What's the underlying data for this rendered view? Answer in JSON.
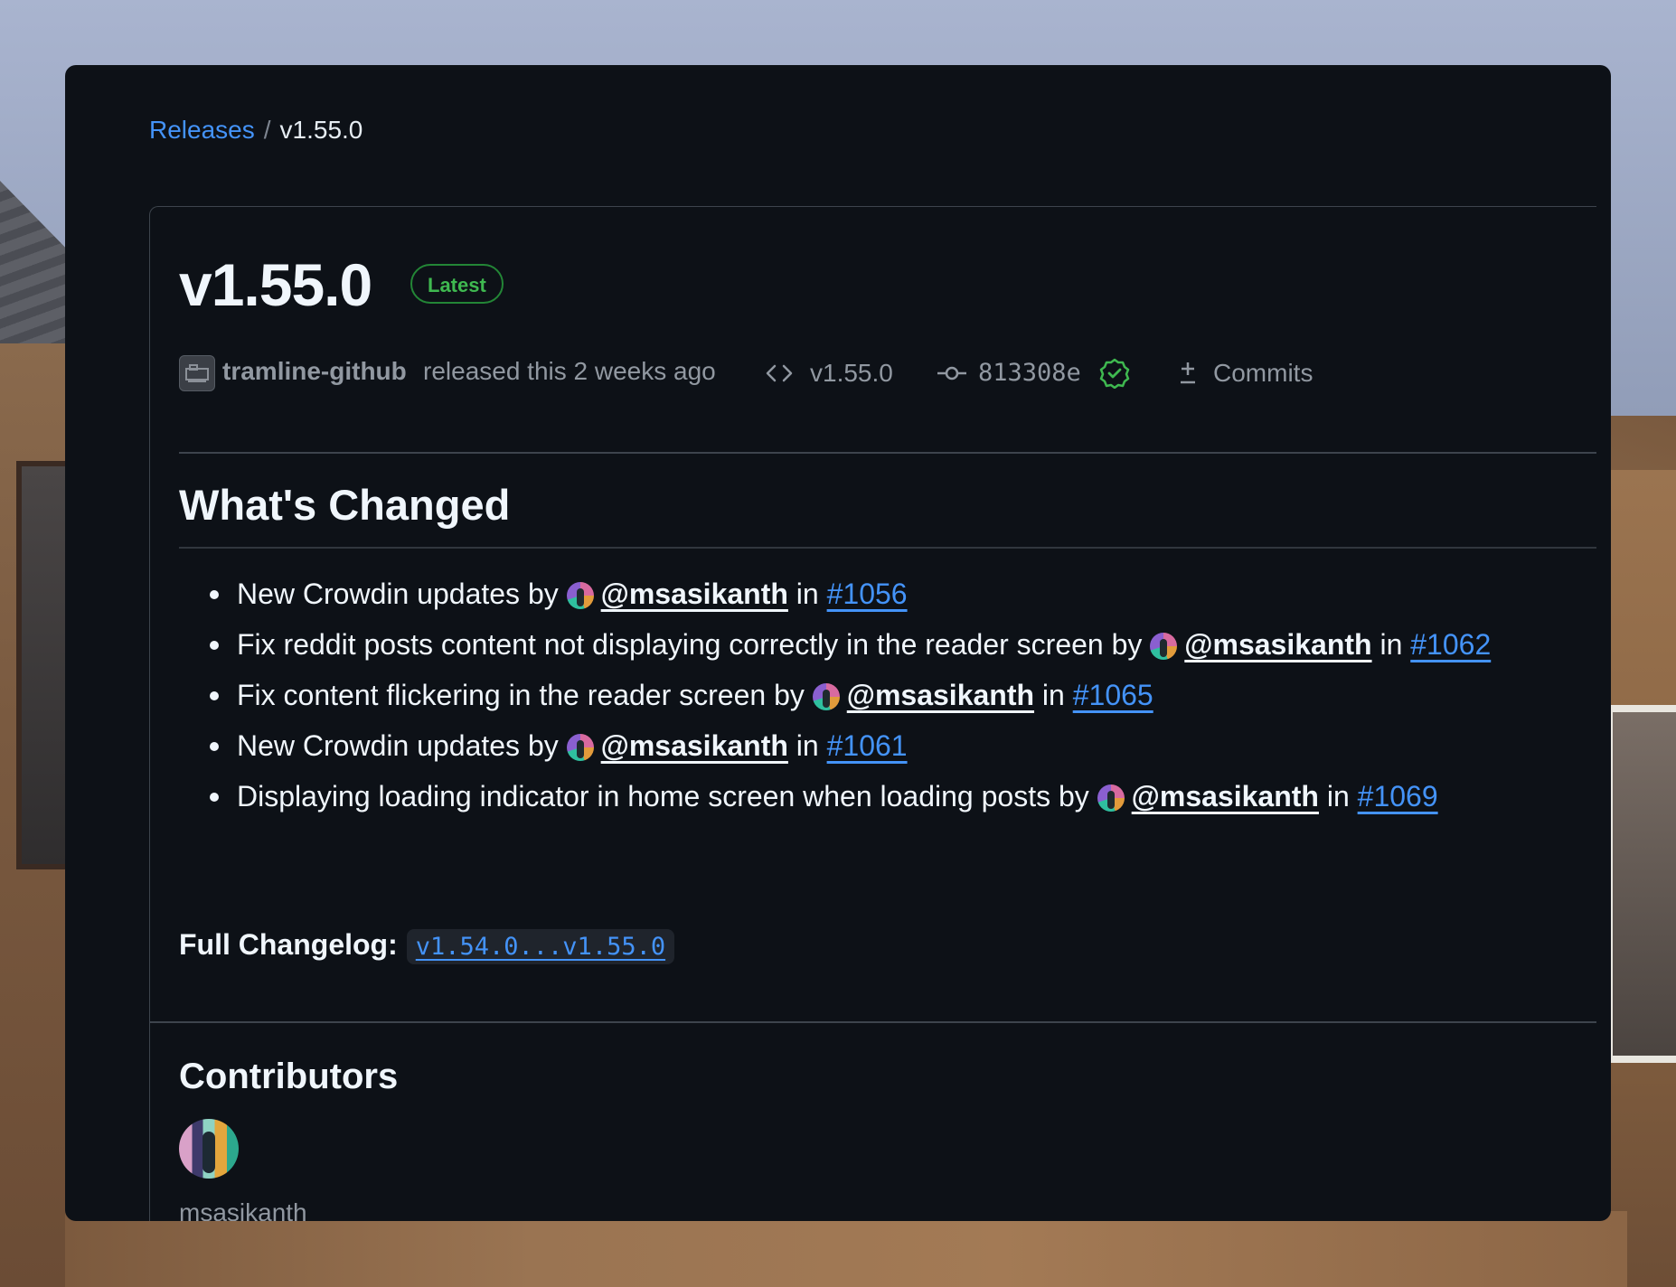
{
  "breadcrumb": {
    "parent": "Releases",
    "separator": "/",
    "current": "v1.55.0"
  },
  "release": {
    "title": "v1.55.0",
    "badge": "Latest",
    "author": "tramline-github",
    "released_text": "released this 2 weeks ago",
    "tag": "v1.55.0",
    "commit": "813308e",
    "commits_label": "Commits"
  },
  "changes": {
    "heading": "What's Changed",
    "items": [
      {
        "text": "New Crowdin updates by",
        "user": "@msasikanth",
        "in": "in",
        "pr": "#1056"
      },
      {
        "text": "Fix reddit posts content not displaying correctly in the reader screen by",
        "user": "@msasikanth",
        "in": "in",
        "pr": "#1062"
      },
      {
        "text": "Fix content flickering in the reader screen by",
        "user": "@msasikanth",
        "in": "in",
        "pr": "#1065"
      },
      {
        "text": "New Crowdin updates by",
        "user": "@msasikanth",
        "in": "in",
        "pr": "#1061"
      },
      {
        "text": "Displaying loading indicator in home screen when loading posts by",
        "user": "@msasikanth",
        "in": "in",
        "pr": "#1069"
      }
    ],
    "full_changelog_label": "Full Changelog:",
    "full_changelog_link": "v1.54.0...v1.55.0"
  },
  "contributors": {
    "heading": "Contributors",
    "names": [
      "msasikanth"
    ]
  },
  "icons": {
    "tag": "code-icon",
    "commit": "git-commit-icon",
    "verified": "verified-check-icon",
    "commits": "git-compare-icon"
  },
  "colors": {
    "card_bg": "#0d1117",
    "link": "#4493f8",
    "latest_green": "#3fb950",
    "muted": "#9198a1"
  }
}
